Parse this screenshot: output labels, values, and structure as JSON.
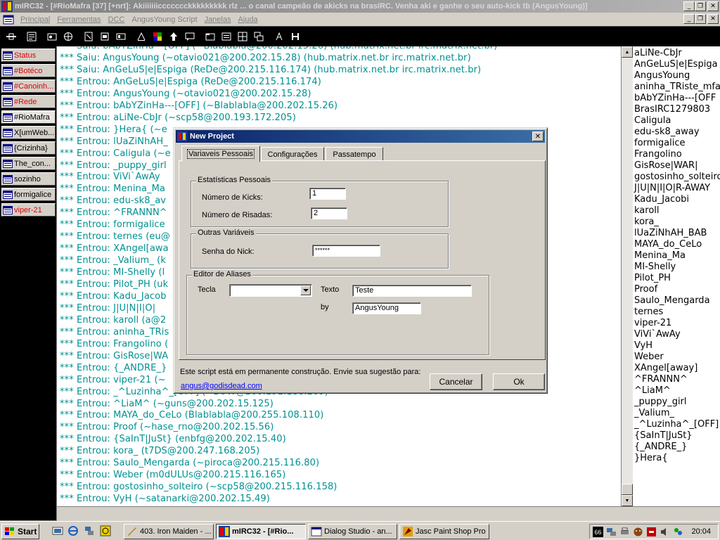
{
  "window": {
    "title": "mIRC32 - [#RioMafra [37] [+nrt]: Akiiiiiiiccccccckkkkkkkkk rlz ... o canal campeão de akicks na brasIRC. Venha aki e ganhe o seu auto-kick tb (AngusYoung)]"
  },
  "menu": {
    "items": [
      "Principal",
      "Ferramentas",
      "DCC",
      "AngusYoung Script",
      "Janelas",
      "Ajuda"
    ]
  },
  "switchbar": {
    "items": [
      {
        "label": "Status",
        "red": true
      },
      {
        "label": "#Botéco",
        "red": true
      },
      {
        "label": "#Canoinh...",
        "red": true
      },
      {
        "label": "#Rede",
        "red": true
      },
      {
        "label": "#RioMafra",
        "red": false
      },
      {
        "label": "X[umWeb...",
        "red": false
      },
      {
        "label": "{Crizinha}",
        "red": false
      },
      {
        "label": "The_con...",
        "red": false
      },
      {
        "label": "sozinho",
        "red": false
      },
      {
        "label": "formigalice",
        "red": false
      },
      {
        "label": "viper-21",
        "red": true
      }
    ]
  },
  "chat": {
    "lines": [
      "*** Saiu: bAbYZinHa---[OFF] (~Blablabla@200.202.15.26) (hub.matrix.net.br irc.matrix.net.br)",
      "*** Saiu: AngusYoung (~otavio021@200.202.15.28) (hub.matrix.net.br irc.matrix.net.br)",
      "*** Saiu: AnGeLuS|e|Espiga (ReDe@200.215.116.174) (hub.matrix.net.br irc.matrix.net.br)",
      "*** Entrou: AnGeLuS|e|Espiga (ReDe@200.215.116.174)",
      "*** Entrou: AngusYoung (~otavio021@200.202.15.28)",
      "*** Entrou: bAbYZinHa---[OFF] (~Blablabla@200.202.15.26)",
      "*** Entrou: aLiNe-CbJr (~scp58@200.193.172.205)",
      "*** Entrou: }Hera{ (~e",
      "*** Entrou: lUaZiNhAH_",
      "*** Entrou: Caligula (~e",
      "*** Entrou: _puppy_girl",
      "*** Entrou: ViVi`AwAy",
      "*** Entrou: Menina_Ma",
      "*** Entrou: edu-sk8_av",
      "*** Entrou: ^FRANNN^",
      "*** Entrou: formigalice",
      "*** Entrou: ternes (eu@",
      "*** Entrou: XAngel[awa",
      "*** Entrou: _Valium_ (k",
      "*** Entrou: MI-Shelly (l",
      "*** Entrou: Pilot_PH (uk",
      "*** Entrou: Kadu_Jacob",
      "*** Entrou: J|U|N|I|O|",
      "*** Entrou: karoll (a@2",
      "*** Entrou: aninha_TRis",
      "*** Entrou: Frangolino (",
      "*** Entrou: GisRose|WA",
      "*** Entrou: {_ANDRE_}",
      "*** Entrou: viper-21 (~",
      "*** Entrou: _^Luzinha^_[OFF] (~BOW@200.191.188.209)",
      "*** Entrou: ^LiaM^ (~guns@200.202.15.125)",
      "*** Entrou: MAYA_do_CeLo (Blablabla@200.255.108.110)",
      "*** Entrou: Proof (~hase_rno@200.202.15.56)",
      "*** Entrou: {SaInT|JuSt} (enbfg@200.202.15.40)",
      "*** Entrou: kora_ (t7DS@200.247.168.205)",
      "*** Entrou: Saulo_Mengarda (~piroca@200.215.116.80)",
      "*** Entrou: Weber (m0dULUs@200.215.116.165)",
      "*** Entrou: gostosinho_solteiro (~scp58@200.215.116.158)",
      "*** Entrou: VyH (~satanarki@200.202.15.49)"
    ]
  },
  "nicklist": {
    "nicks": [
      "aLiNe-CbJr",
      "AnGeLuS|e|Espiga",
      "AngusYoung",
      "aninha_TRiste_mfa",
      "bAbYZinHa---[OFF",
      "BrasIRC1279803",
      "Caligula",
      "edu-sk8_away",
      "formigalice",
      "Frangolino",
      "GisRose|WAR|",
      "gostosinho_solteiro",
      "J|U|N|I|O|R-AWAY",
      "Kadu_Jacobi",
      "karoll",
      "kora_",
      "lUaZiNhAH_BAB",
      "MAYA_do_CeLo",
      "Menina_Ma",
      "MI-Shelly",
      "Pilot_PH",
      "Proof",
      "Saulo_Mengarda",
      "ternes",
      "viper-21",
      "ViVi`AwAy",
      "VyH",
      "Weber",
      "XAngel[away]",
      "^FRANNN^",
      "^LiaM^",
      "_puppy_girl",
      "_Valium_",
      "_^Luzinha^_[OFF]",
      "{SaInT|JuSt}",
      "{_ANDRE_}",
      "}Hera{"
    ]
  },
  "dialog": {
    "title": "New Project",
    "tabs": [
      "Variaveis Pessoais",
      "Configurações",
      "Passatempo"
    ],
    "stats_group": "Estatísticas Pessoais",
    "kicks_label": "Número de Kicks:",
    "kicks_value": "1",
    "risadas_label": "Número de Risadas:",
    "risadas_value": "2",
    "other_group": "Outras Variáveis",
    "senha_label": "Senha do Nick:",
    "senha_value": "******",
    "alias_group": "Editor de Aliases",
    "tecla_label": "Tecla",
    "tecla_value": "",
    "texto_label": "Texto",
    "texto_value": "Teste",
    "by_label": "by",
    "by_value": "AngusYoung",
    "note": "Este script está em permanente construção. Envie sua sugestão para:",
    "email": "angus@godisdead.com",
    "cancel": "Cancelar",
    "ok": "Ok"
  },
  "taskbar": {
    "start": "Start",
    "tasks": [
      "403. Iron Maiden - ...",
      "mIRC32 - [#Rio...",
      "Dialog Studio - an...",
      "Jasc Paint Shop Pro"
    ],
    "clock": "20:04",
    "tray_badge": "66"
  },
  "colors": {
    "chat_text": "#009090",
    "switch_red": "#e00000",
    "dialog_title_start": "#0a246a",
    "dialog_title_end": "#3a6ea5"
  }
}
